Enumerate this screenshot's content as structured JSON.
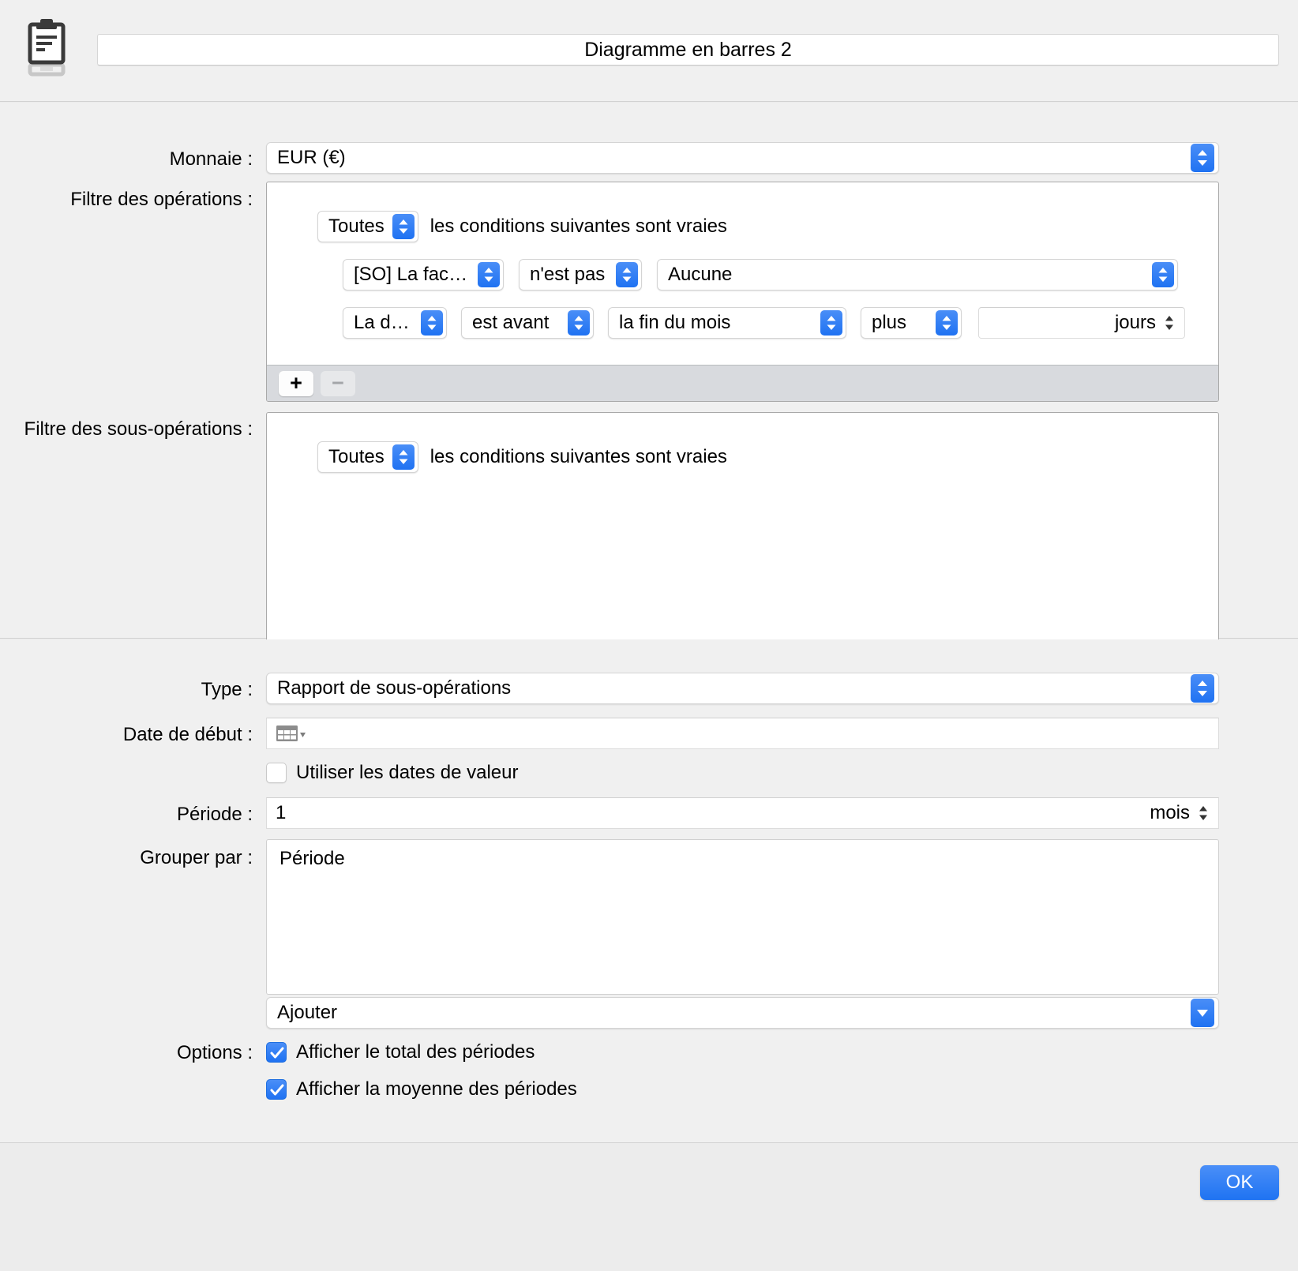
{
  "window": {
    "title": "Diagramme en barres 2",
    "icon": "clipboard-icon"
  },
  "filters": {
    "currency_label": "Monnaie :",
    "currency_value": "EUR (€)",
    "operations_filter_label": "Filtre des opérations :",
    "suboperations_filter_label": "Filtre des sous-opérations :",
    "match_value": "Toutes",
    "match_sentence": "les conditions suivantes sont vraies",
    "add_button": "+",
    "remove_button": "−",
    "rules": [
      {
        "field": "[SO] La factu...",
        "operator": "n'est pas",
        "value": "Aucune"
      },
      {
        "field": "La date",
        "operator": "est avant",
        "anchor": "la fin du mois",
        "modifier": "plus",
        "amount": "",
        "unit": "jours"
      }
    ],
    "sub_match_value": "Toutes",
    "sub_match_sentence": "les conditions suivantes sont vraies"
  },
  "options": {
    "type_label": "Type :",
    "type_value": "Rapport de sous-opérations",
    "start_date_label": "Date de début :",
    "start_date_value": "",
    "use_value_dates_label": "Utiliser les dates de valeur",
    "use_value_dates_checked": false,
    "period_label": "Période :",
    "period_value": "1",
    "period_unit": "mois",
    "group_by_label": "Grouper par :",
    "group_by_items": [
      "Période"
    ],
    "add_popup_value": "Ajouter",
    "options_label": "Options :",
    "checkboxes": [
      {
        "label": "Afficher le total des périodes",
        "checked": true
      },
      {
        "label": "Afficher la moyenne des périodes",
        "checked": true
      }
    ]
  },
  "footer": {
    "ok_label": "OK"
  },
  "colors": {
    "accent_blue": "#1f73f2",
    "panel_bg": "#f0f0f0",
    "footer_bg": "#ececec",
    "filter_footer_bg": "#d8dade"
  }
}
